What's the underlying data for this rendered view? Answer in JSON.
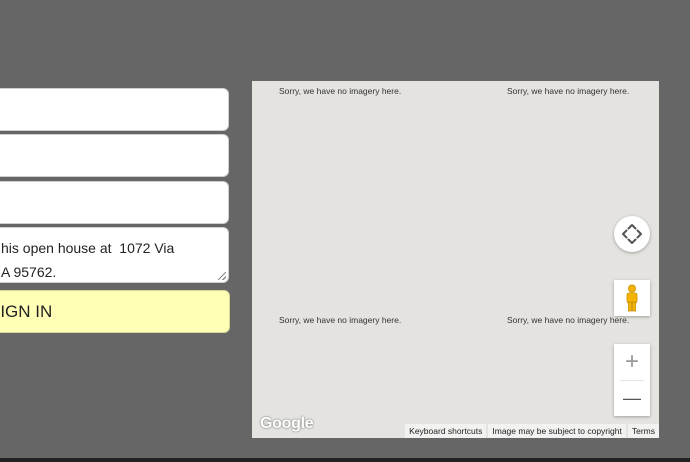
{
  "form": {
    "message_line1": "his open house at  1072 Via",
    "message_line2": "A 95762.",
    "signin_label": "SIGN IN"
  },
  "map": {
    "no_imagery": "Sorry, we have no imagery here.",
    "logo_text": "Google",
    "attribution": {
      "shortcuts": "Keyboard shortcuts",
      "copyright": "Image may be subject to copyright",
      "terms": "Terms"
    },
    "controls": {
      "zoom_in": "+",
      "zoom_out": "—"
    }
  },
  "colors": {
    "page_bg": "#666666",
    "signin_bg": "#ffffb5",
    "map_bg": "#e4e3df"
  }
}
